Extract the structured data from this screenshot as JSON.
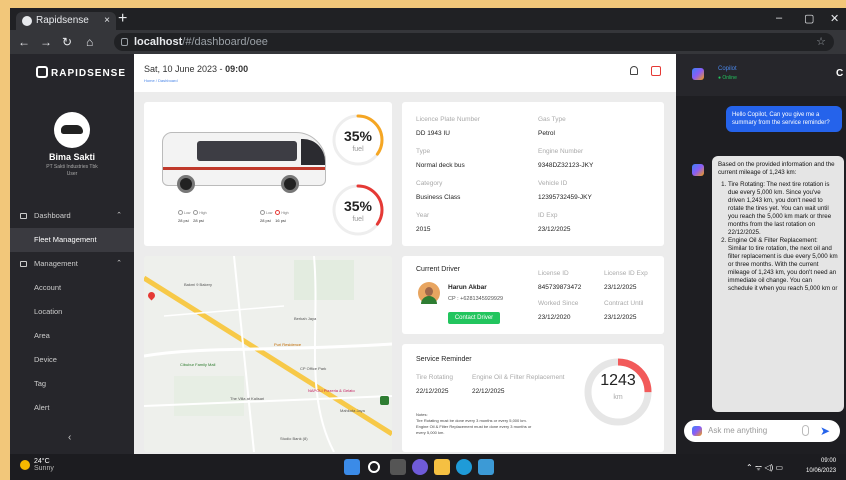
{
  "browser": {
    "tab_title": "Rapidsense",
    "tab_close": "×",
    "new_tab": "+",
    "host": "localhost",
    "path": "/#/dashboard/oee",
    "win_min": "–",
    "win_max": "▢",
    "win_close": "✕",
    "back": "←",
    "forward": "→",
    "reload": "↻",
    "home": "⌂",
    "star": "☆"
  },
  "sidebar": {
    "brand": "RAPIDSENSE",
    "user_name": "Bima Sakti",
    "company": "PT Sakti Industries Tbk",
    "role": "User",
    "items": [
      {
        "label": "Dashboard",
        "chevron": "⌃"
      },
      {
        "label": "Fleet Management"
      },
      {
        "label": "Management",
        "chevron": "⌃"
      },
      {
        "label": "Account"
      },
      {
        "label": "Location"
      },
      {
        "label": "Area"
      },
      {
        "label": "Device"
      },
      {
        "label": "Tag"
      },
      {
        "label": "Alert"
      }
    ],
    "collapse": "‹"
  },
  "header": {
    "date": "Sat, 10 June 2023 - ",
    "time": "09:00",
    "breadcrumb": "Home / Dashboard"
  },
  "vehicle": {
    "fuel1_pct": 35,
    "fuel1_text": "35%",
    "fuel1_label": "fuel",
    "fuel2_pct": 35,
    "fuel2_text": "35%",
    "fuel2_label": "fuel",
    "tires": [
      {
        "l": "Low",
        "r": "High",
        "lv": "28 psi",
        "rv": "28 psi"
      },
      {
        "l": "Low",
        "r": "High",
        "lv": "28 psi",
        "rv": "16 psi"
      }
    ]
  },
  "info": {
    "fields": [
      {
        "label": "Licence Plate Number",
        "value": "DD 1943 IU"
      },
      {
        "label": "Gas Type",
        "value": "Petrol"
      },
      {
        "label": "Type",
        "value": "Normal deck bus"
      },
      {
        "label": "Engine Number",
        "value": "9348DZ32123-JKY"
      },
      {
        "label": "Category",
        "value": "Business Class"
      },
      {
        "label": "Vehicle ID",
        "value": "12395732459-JKY"
      },
      {
        "label": "Year",
        "value": "2015"
      },
      {
        "label": "ID Exp",
        "value": "23/12/2025"
      }
    ]
  },
  "driver": {
    "title": "Current Driver",
    "name": "Harun Akbar",
    "phone": "CP : +6281345929929",
    "button": "Contact Driver",
    "fields": [
      {
        "label": "License ID",
        "value": "845739873472"
      },
      {
        "label": "License ID Exp",
        "value": "23/12/2025"
      },
      {
        "label": "Worked Since",
        "value": "23/12/2020"
      },
      {
        "label": "Contract Until",
        "value": "23/12/2025"
      }
    ]
  },
  "service": {
    "title": "Service Reminder",
    "col1_label": "Tire Rotating",
    "col1_value": "22/12/2025",
    "col2_label": "Engine Oil & Filter Replacement",
    "col2_value": "22/12/2025",
    "km_value": "1243",
    "km_unit": "km",
    "km_fraction": 0.25,
    "notes_title": "Notes:",
    "note1": "Tire Rotating must be done every 3 months or every 5,000 km.",
    "note2": "Engine Oil & Filter Replacement must be done every 3 months or",
    "note3": "every 5,000 km."
  },
  "map": {
    "labels": [
      "Bakmi 9 Bakery",
      "Berkah Jaya",
      "Cibubur Family Mall",
      "Puri Residence",
      "CP Office Park",
      "NAPOLI Pizzeria & Gelato",
      "The Villa at Kalisari",
      "Mahkota Jaya",
      "Studio Bank (8)"
    ]
  },
  "copilot": {
    "title": "Copilot",
    "status": "● Online",
    "refresh": "C",
    "user_msg": "Hello Copilot, Can you give me a summary from the service reminder?",
    "bot_intro": "Based on the provided information and the current mileage of 1,243 km:",
    "bot_p1": "Tire Rotating: The next tire rotation is due every 5,000 km. Since you've driven 1,243 km, you don't need to rotate the tires yet. You can wait until you reach the 5,000 km mark or three months from the last rotation on 22/12/2025.",
    "bot_p2": "Engine Oil & Filter Replacement: Similar to tire rotation, the next oil and filter replacement is due every 5,000 km or three months. With the current mileage of 1,243 km, you don't need an immediate oil change. You can schedule it when you reach 5,000 km or",
    "input_placeholder": "Ask me anything",
    "send": "➤"
  },
  "taskbar": {
    "temp": "24°C",
    "condition": "Sunny",
    "tray": "⌃  ᯤ ◁) ▭",
    "time": "09:00",
    "date": "10/06/2023"
  }
}
